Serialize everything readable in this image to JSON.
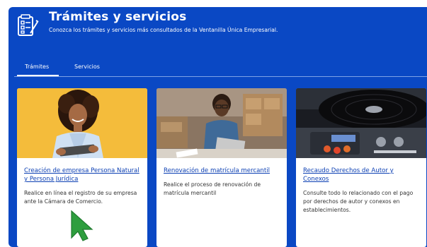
{
  "header": {
    "title": "Trámites y servicios",
    "subtitle": "Conozca los trámites y servicios más consultados de la Ventanilla Única Empresarial.",
    "icon": "checklist-icon"
  },
  "tabs": [
    {
      "label": "Trámites",
      "active": true
    },
    {
      "label": "Servicios",
      "active": false
    }
  ],
  "cards": [
    {
      "title": "Creación de empresa Persona Natural y Persona Jurídica",
      "description": "Realice en línea el registro de su empresa ante la Cámara de Comercio.",
      "image": "woman-with-tablet-photo"
    },
    {
      "title": "Renovación de matrícula mercantil",
      "description": "Realice el proceso de renovación de matrícula mercantil",
      "image": "man-with-laptop-photo"
    },
    {
      "title": "Recaudo Derechos de Autor y Conexos",
      "description": "Consulte todo lo relacionado con el pago por derechos de autor y conexos en establecimientos.",
      "image": "turntable-photo"
    }
  ],
  "colors": {
    "panel": "#0a48c4",
    "link": "#0b3fb3",
    "cursor": "#2e9e3e"
  }
}
